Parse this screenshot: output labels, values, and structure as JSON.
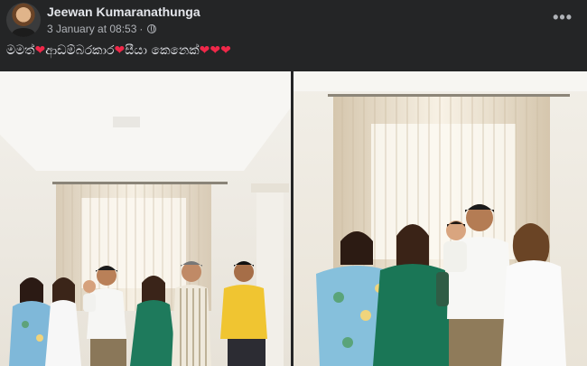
{
  "post": {
    "author": "Jeewan Kumaranathunga",
    "timestamp": "3 January at 08:53",
    "privacy_icon": "globe-icon",
    "more_icon": "more-options-icon",
    "more_label": "•••",
    "caption_parts": [
      "මමත්",
      "ආඩම්බරකාර",
      "සීයා කෙනෙක්"
    ],
    "heart": "❤"
  },
  "colors": {
    "background": "#242526",
    "text_primary": "#e4e6eb",
    "text_secondary": "#b0b3b8",
    "heart": "#f02849"
  }
}
